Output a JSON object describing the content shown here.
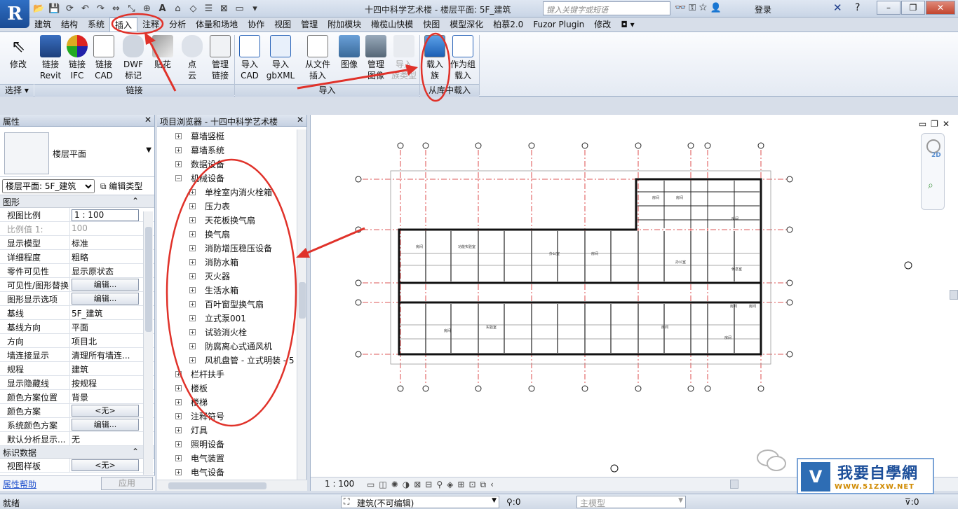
{
  "window": {
    "title": "十四中科学艺术楼 - 楼层平面: 5F_建筑",
    "search_placeholder": "键入关键字或短语",
    "login_label": "登录",
    "app_icon": "R"
  },
  "qat_icons": [
    "open-icon",
    "save-icon",
    "sync-icon",
    "undo-icon",
    "redo-icon",
    "measure-icon",
    "dimension-icon",
    "tag-icon",
    "text-icon",
    "3d-icon",
    "section-icon",
    "thin-lines-icon",
    "close-hidden-icon",
    "switch-windows-icon",
    "customize-icon"
  ],
  "ribbon": {
    "tabs": [
      "建筑",
      "结构",
      "系统",
      "插入",
      "注释",
      "分析",
      "体量和场地",
      "协作",
      "视图",
      "管理",
      "附加模块",
      "橄榄山快模",
      "快图",
      "模型深化",
      "柏慕2.0",
      "Fuzor Plugin",
      "修改"
    ],
    "active_tab": "插入",
    "buttons": [
      {
        "label1": "修改",
        "label2": ""
      },
      {
        "label1": "链接",
        "label2": "Revit"
      },
      {
        "label1": "链接",
        "label2": "IFC"
      },
      {
        "label1": "链接",
        "label2": "CAD"
      },
      {
        "label1": "DWF",
        "label2": "标记"
      },
      {
        "label1": "贴花",
        "label2": ""
      },
      {
        "label1": "点",
        "label2": "云"
      },
      {
        "label1": "管理",
        "label2": "链接"
      },
      {
        "label1": "导入",
        "label2": "CAD"
      },
      {
        "label1": "导入",
        "label2": "gbXML"
      },
      {
        "label1": "从文件",
        "label2": "插入"
      },
      {
        "label1": "图像",
        "label2": ""
      },
      {
        "label1": "管理",
        "label2": "图像"
      },
      {
        "label1": "导入",
        "label2": "族类型"
      },
      {
        "label1": "载入",
        "label2": "族"
      },
      {
        "label1": "作为组",
        "label2": "载入"
      }
    ],
    "groups": [
      "选择",
      "链接",
      "导入",
      "从库中载入"
    ]
  },
  "properties": {
    "header": "属性",
    "type_name": "楼层平面",
    "instance_filter": "楼层平面: 5F_建筑",
    "edit_type_label": "编辑类型",
    "section_graphics": "图形",
    "section_identity": "标识数据",
    "rows": [
      {
        "k": "视图比例",
        "v": "1 : 100",
        "kind": "box"
      },
      {
        "k": "比例值 1:",
        "v": "100",
        "kind": "dim"
      },
      {
        "k": "显示模型",
        "v": "标准",
        "kind": "text"
      },
      {
        "k": "详细程度",
        "v": "粗略",
        "kind": "text"
      },
      {
        "k": "零件可见性",
        "v": "显示原状态",
        "kind": "text"
      },
      {
        "k": "可见性/图形替换",
        "v": "编辑...",
        "kind": "btn"
      },
      {
        "k": "图形显示选项",
        "v": "编辑...",
        "kind": "btn"
      },
      {
        "k": "基线",
        "v": "5F_建筑",
        "kind": "text"
      },
      {
        "k": "基线方向",
        "v": "平面",
        "kind": "text"
      },
      {
        "k": "方向",
        "v": "项目北",
        "kind": "text"
      },
      {
        "k": "墙连接显示",
        "v": "清理所有墙连...",
        "kind": "text"
      },
      {
        "k": "规程",
        "v": "建筑",
        "kind": "text"
      },
      {
        "k": "显示隐藏线",
        "v": "按规程",
        "kind": "text"
      },
      {
        "k": "颜色方案位置",
        "v": "背景",
        "kind": "text"
      },
      {
        "k": "颜色方案",
        "v": "<无>",
        "kind": "btn"
      },
      {
        "k": "系统颜色方案",
        "v": "编辑...",
        "kind": "btn"
      },
      {
        "k": "默认分析显示...",
        "v": "无",
        "kind": "text"
      }
    ],
    "identity_rows": [
      {
        "k": "视图样板",
        "v": "<无>",
        "kind": "btn"
      }
    ],
    "help_label": "属性帮助",
    "apply_label": "应用"
  },
  "browser": {
    "header": "项目浏览器 - 十四中科学艺术楼",
    "items": [
      {
        "label": "幕墙竖梃",
        "level": 1
      },
      {
        "label": "幕墙系统",
        "level": 1
      },
      {
        "label": "数据设备",
        "level": 1
      },
      {
        "label": "机械设备",
        "level": 1,
        "expanded": true
      },
      {
        "label": "单栓室内消火栓箱",
        "level": 2
      },
      {
        "label": "压力表",
        "level": 2
      },
      {
        "label": "天花板换气扇",
        "level": 2
      },
      {
        "label": "换气扇",
        "level": 2
      },
      {
        "label": "消防增压稳压设备",
        "level": 2
      },
      {
        "label": "消防水箱",
        "level": 2
      },
      {
        "label": "灭火器",
        "level": 2
      },
      {
        "label": "生活水箱",
        "level": 2
      },
      {
        "label": "百叶窗型换气扇",
        "level": 2
      },
      {
        "label": "立式泵001",
        "level": 2
      },
      {
        "label": "试验消火栓",
        "level": 2
      },
      {
        "label": "防腐离心式通风机",
        "level": 2
      },
      {
        "label": "风机盘管 - 立式明装 - 5",
        "level": 2
      },
      {
        "label": "栏杆扶手",
        "level": 1
      },
      {
        "label": "楼板",
        "level": 1
      },
      {
        "label": "楼梯",
        "level": 1
      },
      {
        "label": "注释符号",
        "level": 1
      },
      {
        "label": "灯具",
        "level": 1
      },
      {
        "label": "照明设备",
        "level": 1
      },
      {
        "label": "电气装置",
        "level": 1
      },
      {
        "label": "电气设备",
        "level": 1
      }
    ]
  },
  "view": {
    "scale": "1 : 100",
    "nav_2d": "2D",
    "rooms": [
      "房间",
      "房间",
      "房间",
      "房间",
      "功能实验室",
      "办公室",
      "房间",
      "办公室",
      "休息室",
      "房间",
      "房间",
      "房间",
      "实验室",
      "房间",
      "房间"
    ]
  },
  "status": {
    "text": "就绪",
    "workset": "建筑(不可编辑)",
    "workset_count": ":0",
    "model": "主模型",
    "filter_count": ":0"
  },
  "watermark": {
    "title": "我要自學網",
    "url": "WWW.51ZXW.NET"
  },
  "colors": {
    "annotation": "#e0322a",
    "active_tab_bg": "#ffffff",
    "ribbon_bg": "#eef2f8",
    "grid_line": "#d42020"
  }
}
